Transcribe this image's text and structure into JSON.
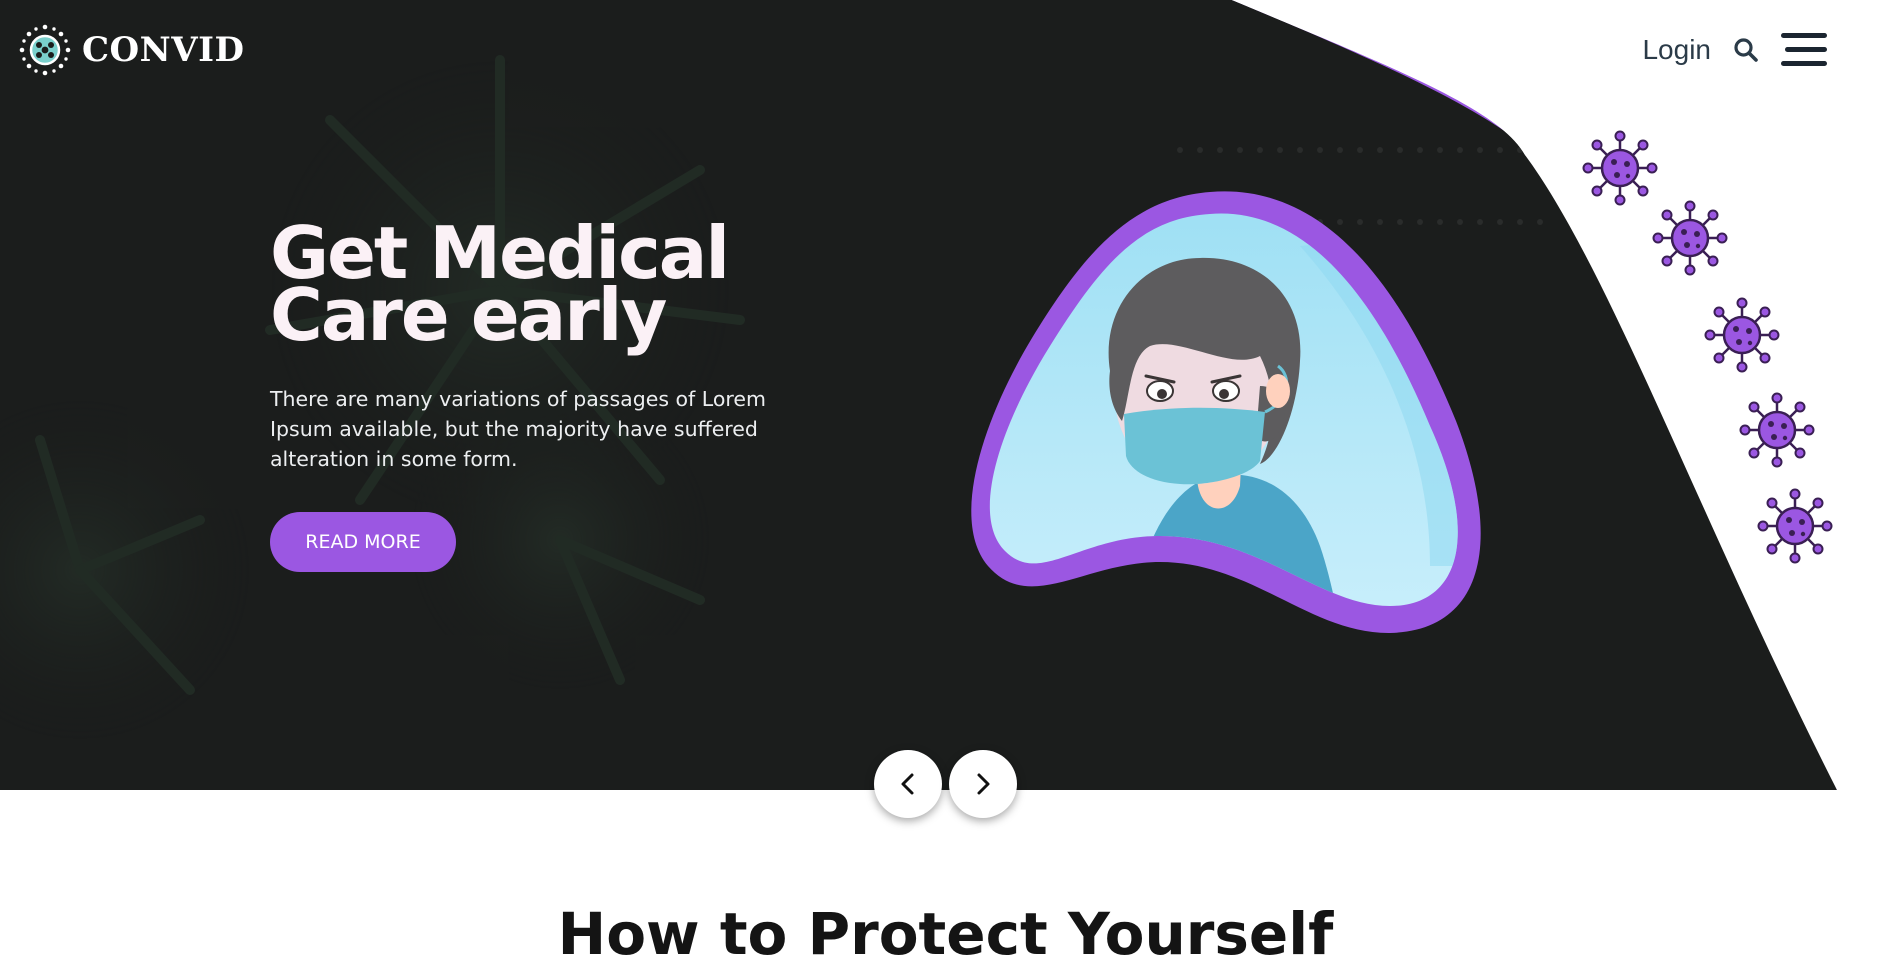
{
  "brand": {
    "name": "CONVID",
    "icon": "virus-logo-icon"
  },
  "nav": {
    "login_label": "Login",
    "search_icon": "search-icon",
    "menu_icon": "hamburger-menu-icon"
  },
  "hero": {
    "title_line1": "Get Medical",
    "title_line2": "Care early",
    "description": "There are many variations of passages of Lorem Ipsum available, but the majority have suffered alteration in some form.",
    "cta_label": "READ MORE"
  },
  "slider": {
    "prev_icon": "chevron-left-icon",
    "next_icon": "chevron-right-icon"
  },
  "next_section": {
    "title": "How to Protect Yourself"
  },
  "colors": {
    "accent": "#9b57e2",
    "hero_bg": "#1b1d1c",
    "nav_text": "#2b3b48"
  }
}
